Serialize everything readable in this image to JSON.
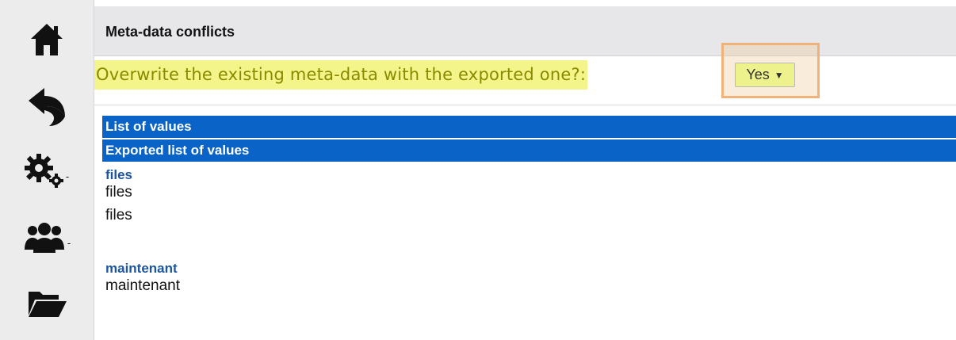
{
  "sidebar": {
    "items": [
      {
        "name": "home",
        "icon": "home-icon"
      },
      {
        "name": "back",
        "icon": "back-arrow-icon"
      },
      {
        "name": "settings",
        "icon": "gears-icon",
        "has_dropdown": true
      },
      {
        "name": "users",
        "icon": "users-icon",
        "has_dropdown": true
      },
      {
        "name": "folder",
        "icon": "folder-open-icon"
      }
    ],
    "dropdown_caret": "-"
  },
  "panel": {
    "title": "Meta-data conflicts"
  },
  "overwrite": {
    "question": "Overwrite the existing meta-data with the exported one?:",
    "selected": "Yes",
    "arrow": "▼",
    "highlight_color": "#f3f58a"
  },
  "lists": {
    "header_1": "List of values",
    "header_2": "Exported list of values",
    "groups": [
      {
        "title": "files",
        "values": [
          "files",
          "files"
        ]
      },
      {
        "title": "maintenant",
        "values": [
          "maintenant"
        ]
      }
    ]
  },
  "colors": {
    "accent_blue": "#0a64c8",
    "group_title": "#1c55a0",
    "highlight_border": "#efb27a"
  }
}
